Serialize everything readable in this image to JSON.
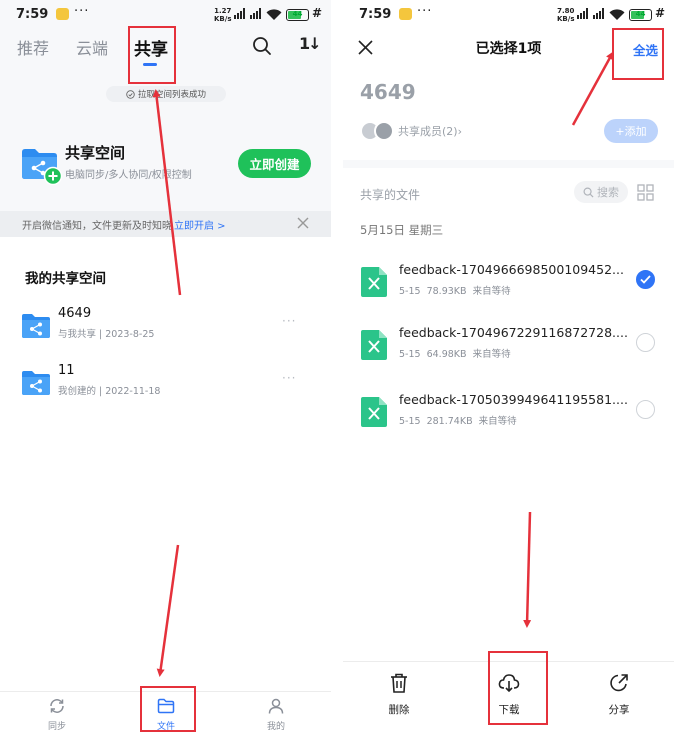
{
  "left": {
    "status": {
      "time": "7:59",
      "dots": "···",
      "speed_top": "1.27",
      "speed_bottom": "KB/s",
      "battery": "44",
      "extra": "#"
    },
    "tabs": [
      {
        "label": "推荐"
      },
      {
        "label": "云端"
      },
      {
        "label": "共享"
      }
    ],
    "toast": "拉取空间列表成功",
    "promo": {
      "title": "共享空间",
      "subtitle": "电脑同步/多人协同/权限控制",
      "button": "立即创建"
    },
    "notice": {
      "text": "开启微信通知，文件更新及时知晓",
      "link": "立即开启 >"
    },
    "section_title": "我的共享空间",
    "spaces": [
      {
        "name": "4649",
        "meta": "与我共享 | 2023-8-25"
      },
      {
        "name": "11",
        "meta": "我创建的 | 2022-11-18"
      }
    ],
    "more": "···",
    "nav": [
      {
        "label": "同步"
      },
      {
        "label": "文件"
      },
      {
        "label": "我的"
      }
    ]
  },
  "right": {
    "status": {
      "time": "7:59",
      "dots": "···",
      "speed_top": "7.80",
      "speed_bottom": "KB/s",
      "battery": "44",
      "extra": "#"
    },
    "title": "已选择1项",
    "select_all": "全选",
    "space_name": "4649",
    "members": "共享成员(2)",
    "add_button": "+添加",
    "files_label": "共享的文件",
    "search_placeholder": "搜索",
    "date_header": "5月15日 星期三",
    "files": [
      {
        "name": "feedback-1704966698500109452...",
        "date": "5-15",
        "size": "78.93KB",
        "source": "来自等待",
        "selected": true
      },
      {
        "name": "feedback-1704967229116872728....",
        "date": "5-15",
        "size": "64.98KB",
        "source": "来自等待",
        "selected": false
      },
      {
        "name": "feedback-1705039949641195581....",
        "date": "5-15",
        "size": "281.74KB",
        "source": "来自等待",
        "selected": false
      }
    ],
    "toolbar": [
      {
        "label": "删除"
      },
      {
        "label": "下载"
      },
      {
        "label": "分享"
      }
    ]
  },
  "colors": {
    "accent": "#2f74f6",
    "green": "#1fc15a",
    "annotation": "#e5313b",
    "file_icon": "#2bc48a"
  }
}
